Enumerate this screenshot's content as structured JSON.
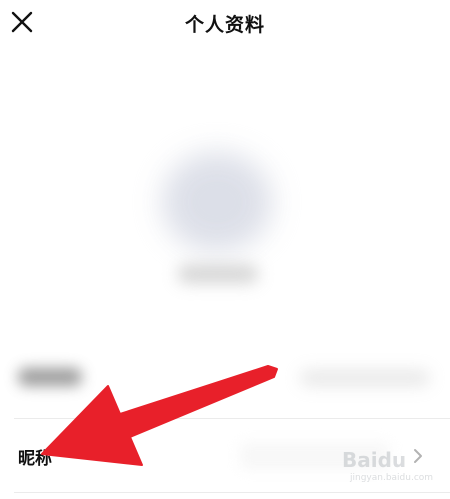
{
  "header": {
    "title": "个人资料",
    "close_icon": "close-icon"
  },
  "profile": {
    "avatar": "blurred",
    "username": "blurred"
  },
  "rows": {
    "nickname": {
      "label": "昵称",
      "chevron_icon": "chevron-right-icon"
    }
  },
  "annotation": {
    "arrow_color": "#e8202a"
  },
  "watermark": {
    "brand": "Baidu",
    "sub": "jingyan.baidu.com"
  },
  "colors": {
    "background": "#ffffff",
    "text": "#111111",
    "divider": "#ebebeb",
    "chevron": "#b3b3b3"
  }
}
